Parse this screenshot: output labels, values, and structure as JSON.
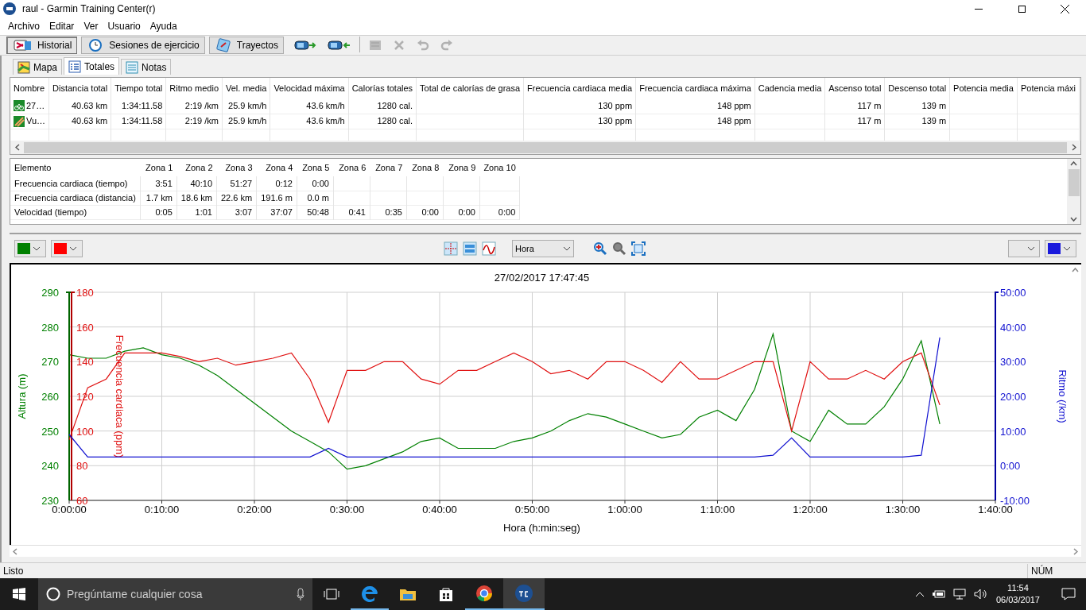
{
  "window": {
    "title": "raul - Garmin Training Center(r)"
  },
  "menu": [
    "Archivo",
    "Editar",
    "Ver",
    "Usuario",
    "Ayuda"
  ],
  "toolbar": {
    "buttons": [
      {
        "label": "Historial",
        "selected": true
      },
      {
        "label": "Sesiones de ejercicio",
        "selected": false
      },
      {
        "label": "Trayectos",
        "selected": false
      }
    ],
    "icon_buttons": [
      {
        "kind": "send",
        "disabled": false
      },
      {
        "kind": "receive",
        "disabled": false
      },
      {
        "kind": "map",
        "disabled": true
      },
      {
        "kind": "delete",
        "disabled": true
      },
      {
        "kind": "undo",
        "disabled": true
      },
      {
        "kind": "redo",
        "disabled": true
      }
    ]
  },
  "tabs": [
    {
      "label": "Mapa",
      "selected": false
    },
    {
      "label": "Totales",
      "selected": true
    },
    {
      "label": "Notas",
      "selected": false
    }
  ],
  "totals": {
    "columns": [
      "Nombre",
      "Distancia total",
      "Tiempo total",
      "Ritmo medio",
      "Vel. media",
      "Velocidad máxima",
      "Calorías totales",
      "Total de calorías de grasa",
      "Frecuencia cardiaca media",
      "Frecuencia cardiaca máxima",
      "Cadencia media",
      "Ascenso total",
      "Descenso total",
      "Potencia media",
      "Potencia máxi"
    ],
    "rows": [
      {
        "kind": "session",
        "cells": [
          "27…",
          "40.63 km",
          "1:34:11.58",
          "2:19 /km",
          "25.9 km/h",
          "43.6 km/h",
          "1280 cal.",
          null,
          "130 ppm",
          "148 ppm",
          null,
          "117 m",
          "139 m",
          null,
          null
        ]
      },
      {
        "kind": "route",
        "cells": [
          "Vu…",
          "40.63 km",
          "1:34:11.58",
          "2:19 /km",
          "25.9 km/h",
          "43.6 km/h",
          "1280 cal.",
          null,
          "130 ppm",
          "148 ppm",
          null,
          "117 m",
          "139 m",
          null,
          null
        ]
      }
    ]
  },
  "zones": {
    "columns": [
      "Elemento",
      "Zona 1",
      "Zona 2",
      "Zona 3",
      "Zona 4",
      "Zona 5",
      "Zona 6",
      "Zona 7",
      "Zona 8",
      "Zona 9",
      "Zona 10"
    ],
    "rows": [
      [
        "Frecuencia cardiaca (tiempo)",
        "3:51",
        "40:10",
        "51:27",
        "0:12",
        "0:00"
      ],
      [
        "Frecuencia cardiaca (distancia)",
        "1.7 km",
        "18.6 km",
        "22.6 km",
        "191.6 m",
        "0.0 m"
      ],
      [
        "Velocidad (tiempo)",
        "0:05",
        "1:01",
        "3:07",
        "37:07",
        "50:48",
        "0:41",
        "0:35",
        "0:00",
        "0:00",
        "0:00"
      ]
    ]
  },
  "chart_toolbar": {
    "pickers": [
      {
        "color": "#008000"
      },
      {
        "color": "#ff0000"
      }
    ],
    "x_mode": "Hora",
    "right_pickers": [
      {
        "color": "#1a1adc"
      }
    ]
  },
  "charts": [
    {
      "chart_data": {
        "type": "line",
        "title": "27/02/2017 17:47:45",
        "xlabel": "Hora (h:min:seg)",
        "ylabel": "Altura (m)",
        "grid": true,
        "x": [
          0,
          2,
          4,
          6,
          8,
          10,
          12,
          14,
          16,
          18,
          20,
          22,
          24,
          26,
          28,
          30,
          32,
          34,
          36,
          38,
          40,
          42,
          44,
          46,
          48,
          50,
          52,
          54,
          56,
          58,
          60,
          62,
          64,
          66,
          68,
          70,
          72,
          74,
          76,
          78,
          80,
          82,
          84,
          86,
          88,
          90,
          92,
          94
        ],
        "xlim": [
          0,
          100
        ],
        "xticks": [
          {
            "value": 0,
            "label": "0:00:00"
          },
          {
            "value": 10,
            "label": "0:10:00"
          },
          {
            "value": 20,
            "label": "0:20:00"
          },
          {
            "value": 30,
            "label": "0:30:00"
          },
          {
            "value": 40,
            "label": "0:40:00"
          },
          {
            "value": 50,
            "label": "0:50:00"
          },
          {
            "value": 60,
            "label": "1:00:00"
          },
          {
            "value": 70,
            "label": "1:10:00"
          },
          {
            "value": 80,
            "label": "1:20:00"
          },
          {
            "value": 90,
            "label": "1:30:00"
          },
          {
            "value": 100,
            "label": "1:40:00"
          }
        ],
        "ylim": [
          230,
          290
        ],
        "yticks": [
          230,
          240,
          250,
          260,
          270,
          280,
          290
        ],
        "series": [
          {
            "color": "#008000",
            "values": [
              272,
              271,
              271,
              273,
              274,
              272,
              271,
              269,
              266,
              262,
              258,
              254,
              250,
              247,
              244,
              239,
              240,
              242,
              244,
              247,
              248,
              245,
              245,
              245,
              247,
              248,
              250,
              253,
              255,
              254,
              252,
              250,
              248,
              249,
              254,
              256,
              253,
              262,
              278,
              250,
              247,
              256,
              252,
              252,
              257,
              265,
              276,
              252
            ]
          }
        ]
      }
    },
    {
      "chart_data": {
        "type": "line",
        "ylabel": "Frecuencia cardiaca (ppm)",
        "x": [
          0,
          2,
          4,
          6,
          8,
          10,
          12,
          14,
          16,
          18,
          20,
          22,
          24,
          26,
          28,
          30,
          32,
          34,
          36,
          38,
          40,
          42,
          44,
          46,
          48,
          50,
          52,
          54,
          56,
          58,
          60,
          62,
          64,
          66,
          68,
          70,
          72,
          74,
          76,
          78,
          80,
          82,
          84,
          86,
          88,
          90,
          92,
          94
        ],
        "xlim": [
          0,
          100
        ],
        "ylim": [
          60,
          180
        ],
        "yticks": [
          60,
          80,
          100,
          120,
          140,
          160,
          180
        ],
        "series": [
          {
            "color": "#e01010",
            "values": [
              95,
              125,
              130,
              145,
              145,
              145,
              143,
              140,
              142,
              138,
              140,
              142,
              145,
              130,
              105,
              135,
              135,
              140,
              140,
              130,
              127,
              135,
              135,
              140,
              145,
              140,
              133,
              135,
              130,
              140,
              140,
              135,
              128,
              140,
              130,
              130,
              135,
              140,
              140,
              100,
              140,
              130,
              130,
              135,
              130,
              140,
              145,
              115
            ]
          }
        ]
      }
    },
    {
      "chart_data": {
        "type": "line",
        "ylabel": "Ritmo (/km)",
        "x": [
          0,
          2,
          4,
          6,
          8,
          10,
          12,
          14,
          16,
          18,
          20,
          22,
          24,
          26,
          28,
          30,
          32,
          34,
          36,
          38,
          40,
          42,
          44,
          46,
          48,
          50,
          52,
          54,
          56,
          58,
          60,
          62,
          64,
          66,
          68,
          70,
          72,
          74,
          76,
          78,
          80,
          82,
          84,
          86,
          88,
          90,
          92,
          94
        ],
        "xlim": [
          0,
          100
        ],
        "ylim": [
          -10,
          50
        ],
        "yticks": [
          {
            "value": -10,
            "label": "-10:00"
          },
          {
            "value": 0,
            "label": "0:00"
          },
          {
            "value": 10,
            "label": "10:00"
          },
          {
            "value": 20,
            "label": "20:00"
          },
          {
            "value": 30,
            "label": "30:00"
          },
          {
            "value": 40,
            "label": "40:00"
          },
          {
            "value": 50,
            "label": "50:00"
          }
        ],
        "series": [
          {
            "color": "#1010d0",
            "values": [
              9,
              2.5,
              2.5,
              2.5,
              2.5,
              2.5,
              2.5,
              2.5,
              2.5,
              2.5,
              2.5,
              2.5,
              2.5,
              2.5,
              5,
              2.5,
              2.5,
              2.5,
              2.5,
              2.5,
              2.5,
              2.5,
              2.5,
              2.5,
              2.5,
              2.5,
              2.5,
              2.5,
              2.5,
              2.5,
              2.5,
              2.5,
              2.5,
              2.5,
              2.5,
              2.5,
              2.5,
              2.5,
              3,
              8,
              2.5,
              2.5,
              2.5,
              2.5,
              2.5,
              2.5,
              3,
              37
            ]
          }
        ]
      }
    }
  ],
  "status_bar": {
    "text": "Listo",
    "indicator": "NÚM"
  },
  "taskbar": {
    "search_placeholder": "Pregúntame cualquier cosa",
    "time": "11:54",
    "date": "06/03/2017"
  }
}
